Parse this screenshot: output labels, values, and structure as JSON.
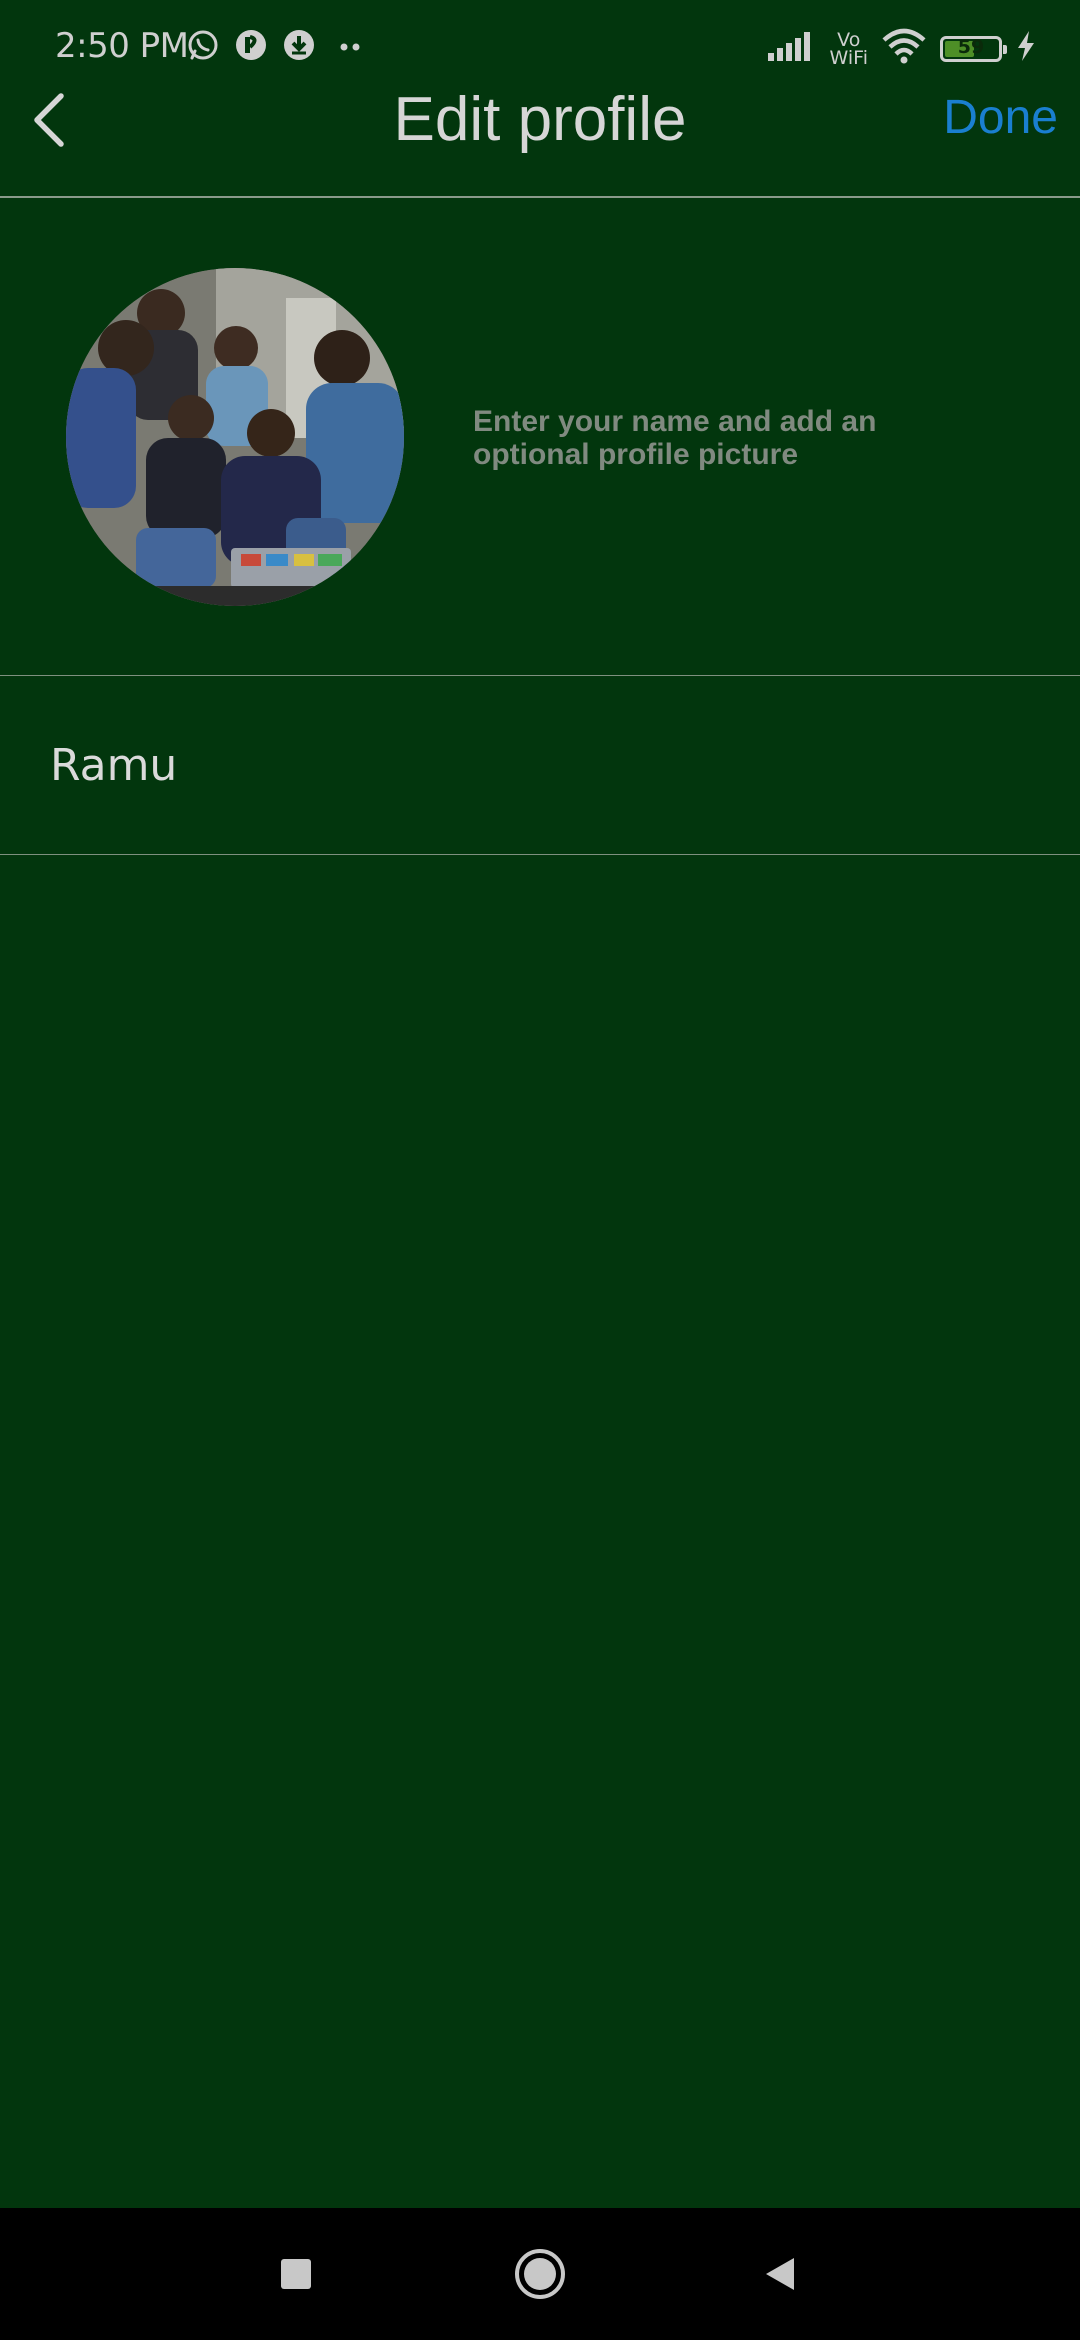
{
  "status_bar": {
    "time": "2:50 PM",
    "network": "VoWiFi",
    "network_line1": "Vo",
    "network_line2": "WiFi",
    "battery_level": "59",
    "battery_fraction": 0.59,
    "icons_left": [
      "whatsapp-icon",
      "app-badge-icon",
      "download-icon",
      "more-dots-icon"
    ],
    "icons_right": [
      "signal-icon",
      "vowifi-icon",
      "wifi-icon",
      "battery-icon",
      "charging-icon"
    ]
  },
  "header": {
    "back_icon": "chevron-left-icon",
    "title": "Edit profile",
    "done_label": "Done"
  },
  "profile": {
    "avatar_alt": "profile picture",
    "hint": "Enter your name and add an optional profile picture"
  },
  "name_field": {
    "value": "Ramu"
  },
  "nav_bar": {
    "buttons": [
      "recents-square-icon",
      "home-circle-icon",
      "back-triangle-icon"
    ]
  },
  "colors": {
    "background": "#02360d",
    "accent": "#1a7fd0",
    "hint": "#808a80",
    "title": "#d6d6d6",
    "nav_background": "#000000"
  }
}
